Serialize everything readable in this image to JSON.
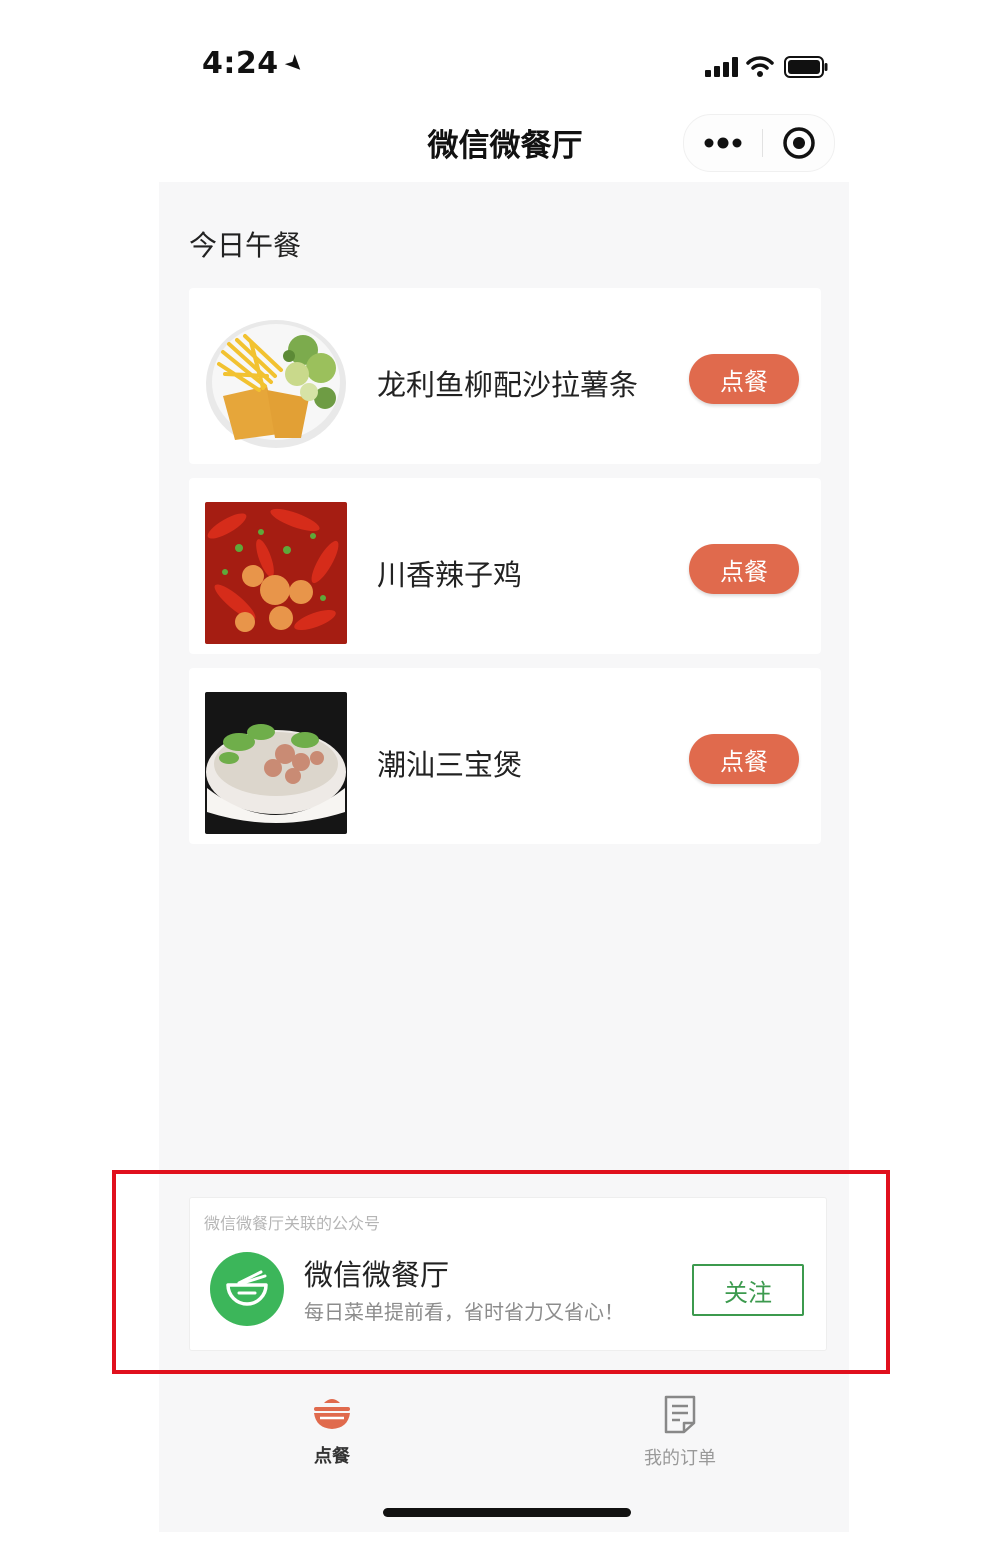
{
  "status_bar": {
    "time": "4:24",
    "location_icon": "location-arrow-icon"
  },
  "header": {
    "title": "微信微餐厅",
    "more_icon": "more-dots-icon",
    "close_icon": "target-close-icon"
  },
  "section": {
    "title": "今日午餐"
  },
  "dishes": [
    {
      "name": "龙利鱼柳配沙拉薯条",
      "button": "点餐",
      "image": "fish-fries-salad-photo"
    },
    {
      "name": "川香辣子鸡",
      "button": "点餐",
      "image": "spicy-chicken-photo"
    },
    {
      "name": "潮汕三宝煲",
      "button": "点餐",
      "image": "chaoshan-pot-photo"
    }
  ],
  "official_account": {
    "caption": "微信微餐厅关联的公众号",
    "name": "微信微餐厅",
    "description": "每日菜单提前看，省时省力又省心！",
    "follow_label": "关注",
    "logo_icon": "bowl-noodles-icon"
  },
  "tabbar": {
    "tabs": [
      {
        "label": "点餐",
        "icon": "bowl-icon",
        "active": true
      },
      {
        "label": "我的订单",
        "icon": "document-icon",
        "active": false
      }
    ]
  },
  "colors": {
    "accent": "#e06a4d",
    "follow": "#3c9a4e",
    "logo": "#3cb65a",
    "highlight": "#e0101d"
  }
}
